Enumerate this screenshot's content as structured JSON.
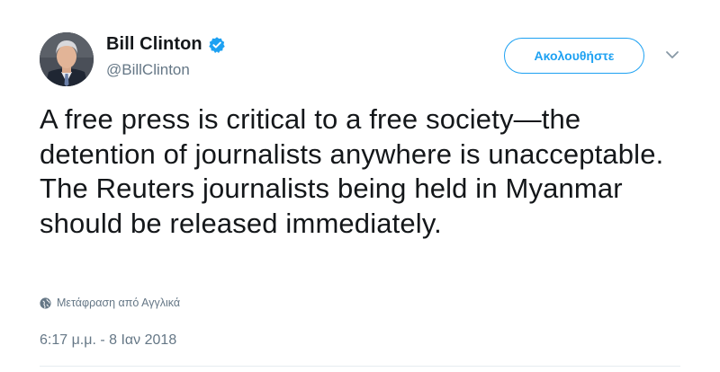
{
  "author": {
    "display_name": "Bill Clinton",
    "handle": "@BillClinton",
    "verified": true
  },
  "follow_button": {
    "label": "Ακολουθήστε"
  },
  "more_menu": {
    "icon": "chevron-down-icon"
  },
  "tweet": {
    "text": "A free press is critical to a free society—the detention of journalists anywhere is unacceptable. The Reuters journalists being held in Myanmar should be released immediately.",
    "translate_label": "Μετάφραση από Αγγλικά",
    "timestamp": "6:17 μ.μ. - 8 Ιαν 2018"
  },
  "colors": {
    "accent": "#1da1f2",
    "text_primary": "#14171a",
    "text_secondary": "#657786"
  }
}
